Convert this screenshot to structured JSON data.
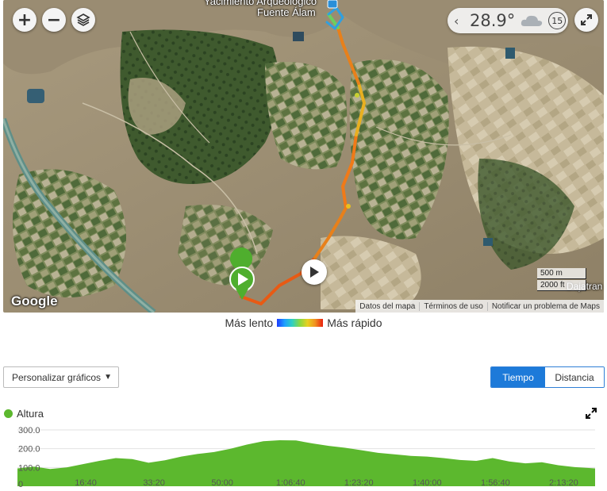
{
  "map": {
    "place_label": "Yacimiento Arqueológico Fuente Álamo",
    "place_label_line1": "Yacimiento Arqueológico",
    "place_label_line2": "Fuente Álam",
    "edge_label": "Dajatran",
    "google_logo": "Google",
    "zoom_in_icon": "plus-icon",
    "zoom_out_icon": "minus-icon",
    "layers_icon": "layers-icon",
    "weather": {
      "temperature": "28.9°",
      "condition_icon": "cloud-icon",
      "time_badge": "15"
    },
    "scale": {
      "metric": "500 m",
      "imperial": "2000 ft"
    },
    "attribution": {
      "data": "Datos del mapa",
      "terms": "Términos de uso",
      "report": "Notificar un problema de Maps"
    }
  },
  "legend": {
    "slow": "Más lento",
    "fast": "Más rápido"
  },
  "controls": {
    "customize_label": "Personalizar gráficos",
    "tabs": [
      {
        "label": "Tiempo",
        "active": true
      },
      {
        "label": "Distancia",
        "active": false
      }
    ]
  },
  "chart_data": {
    "type": "area",
    "title": "Altura",
    "color": "#5cb82e",
    "ylabel": "",
    "xlabel": "",
    "ylim": [
      0,
      300
    ],
    "y_ticks": [
      "300.0",
      "200.0",
      "100.0",
      "0"
    ],
    "x_tick_labels": [
      "16:40",
      "33:20",
      "50:00",
      "1:06:40",
      "1:23:20",
      "1:40:00",
      "1:56:40",
      "2:13:20"
    ],
    "x_tick_minutes": [
      16.67,
      33.33,
      50,
      66.67,
      83.33,
      100,
      116.67,
      133.33
    ],
    "x_max_minutes": 141,
    "grid": true,
    "series": [
      {
        "x": [
          0,
          4,
          8,
          12,
          16,
          20,
          24,
          28,
          32,
          36,
          40,
          44,
          48,
          52,
          56,
          60,
          64,
          68,
          72,
          76,
          80,
          84,
          88,
          92,
          96,
          100,
          104,
          108,
          112,
          116,
          120,
          124,
          128,
          132,
          136,
          141
        ],
        "y": [
          95,
          105,
          92,
          100,
          118,
          135,
          150,
          145,
          125,
          138,
          158,
          172,
          182,
          200,
          222,
          240,
          245,
          244,
          228,
          215,
          205,
          192,
          178,
          170,
          162,
          158,
          150,
          140,
          135,
          150,
          132,
          122,
          128,
          112,
          102,
          95
        ]
      }
    ]
  }
}
